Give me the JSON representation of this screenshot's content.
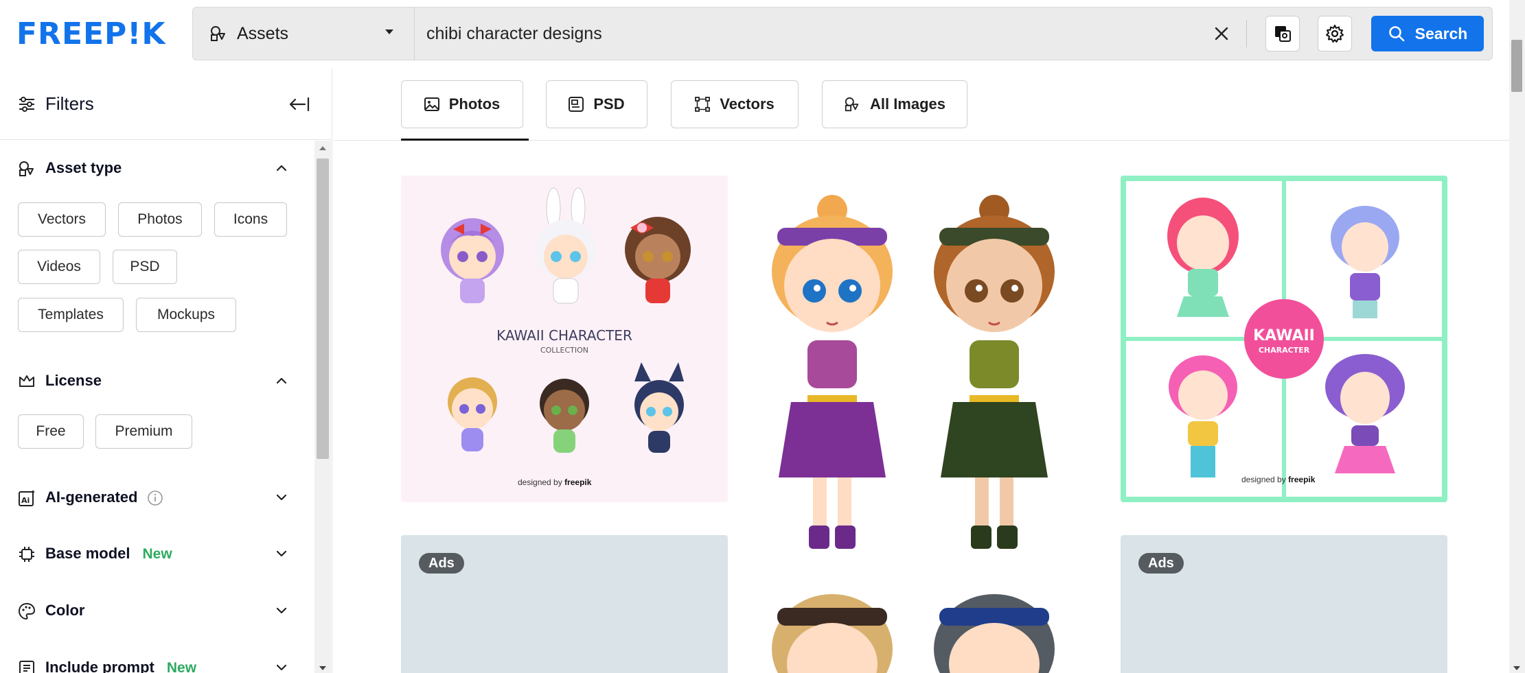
{
  "brand": {
    "logo_text": "FREEP!K",
    "accent": "#1273eb"
  },
  "search": {
    "asset_type": "Assets",
    "query": "chibi character designs",
    "button_label": "Search"
  },
  "sidebar": {
    "title": "Filters",
    "sections": [
      {
        "name": "Asset type",
        "expanded": true,
        "chips": [
          "Vectors",
          "Photos",
          "Icons",
          "Videos",
          "PSD",
          "Templates",
          "Mockups"
        ]
      },
      {
        "name": "License",
        "expanded": true,
        "chips": [
          "Free",
          "Premium"
        ]
      },
      {
        "name": "AI-generated",
        "expanded": false
      },
      {
        "name": "Base model",
        "badge": "New",
        "expanded": false
      },
      {
        "name": "Color",
        "expanded": false
      },
      {
        "name": "Include prompt",
        "badge": "New",
        "expanded": false
      }
    ]
  },
  "tabs": [
    {
      "label": "Photos",
      "icon": "image-icon",
      "active": true
    },
    {
      "label": "PSD",
      "icon": "psd-icon"
    },
    {
      "label": "Vectors",
      "icon": "vector-icon"
    },
    {
      "label": "All Images",
      "icon": "shapes-icon"
    }
  ],
  "results": {
    "card1": {
      "title": "KAWAII CHARACTER",
      "subtitle": "COLLECTION",
      "credit_prefix": "designed by",
      "credit_brand": "freepik"
    },
    "card3": {
      "title_line1": "KAWAII",
      "title_line2": "CHARACTER",
      "credit_prefix": "designed by",
      "credit_brand": "freepik"
    },
    "ad_label": "Ads"
  }
}
